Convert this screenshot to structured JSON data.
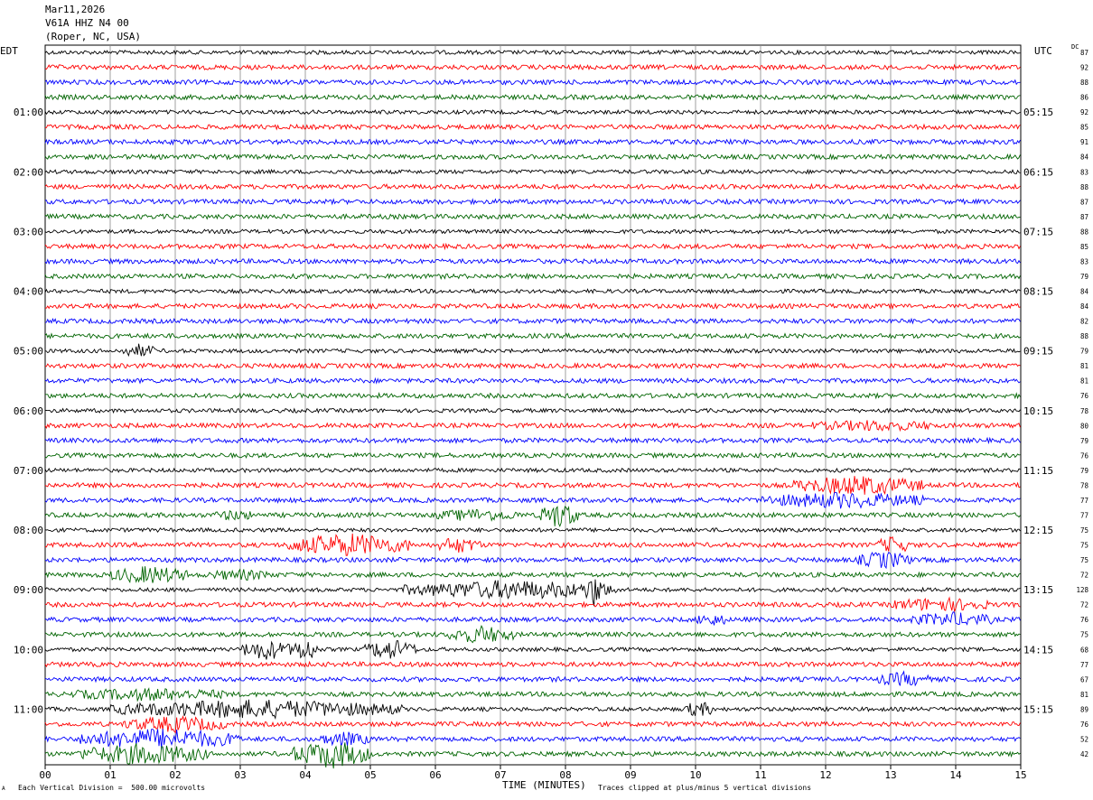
{
  "header": {
    "date": "Mar11,2026",
    "station": "V61A HHZ N4 00",
    "location": "(Roper, NC, USA)"
  },
  "left_tz": "EDT",
  "right_tz": "UTC",
  "dc_label": "DC",
  "colors": {
    "black": "#000000",
    "red": "#ff0000",
    "blue": "#0000ff",
    "green": "#006400"
  },
  "footer": {
    "scale": "Each Vertical Division =  500.00 microvolts",
    "clip": "Traces clipped at plus/minus 5 vertical divisions",
    "xlabel": "TIME (MINUTES)",
    "corner": "A"
  },
  "chart_data": {
    "type": "line",
    "subtype": "helicorder",
    "x_range": [
      0,
      15
    ],
    "x_unit": "minutes",
    "x_ticks": [
      "00",
      "01",
      "02",
      "03",
      "04",
      "05",
      "06",
      "07",
      "08",
      "09",
      "10",
      "11",
      "12",
      "13",
      "14",
      "15"
    ],
    "left_hour_labels": [
      "01:00",
      "02:00",
      "03:00",
      "04:00",
      "05:00",
      "06:00",
      "07:00",
      "08:00",
      "09:00",
      "10:00",
      "11:00"
    ],
    "right_hour_labels": [
      "05:15",
      "06:15",
      "07:15",
      "08:15",
      "09:15",
      "10:15",
      "11:15",
      "12:15",
      "13:15",
      "14:15",
      "15:15"
    ],
    "hour_label_rows": [
      4,
      8,
      12,
      16,
      20,
      24,
      28,
      32,
      36,
      40,
      44
    ],
    "trace_colors_cycle": [
      "black",
      "red",
      "blue",
      "green"
    ],
    "trace_count": 48,
    "dc_values": [
      "87",
      "92",
      "88",
      "86",
      "92",
      "85",
      "91",
      "84",
      "83",
      "88",
      "87",
      "87",
      "88",
      "85",
      "83",
      "79",
      "84",
      "84",
      "82",
      "88",
      "79",
      "81",
      "81",
      "76",
      "78",
      "80",
      "79",
      "76",
      "79",
      "78",
      "77",
      "77",
      "75",
      "75",
      "75",
      "72",
      "128",
      "72",
      "76",
      "75",
      "68",
      "77",
      "67",
      "81",
      "89",
      "76",
      "52",
      "42"
    ],
    "grid": true,
    "clipping": "plus/minus 5 vertical divisions"
  }
}
